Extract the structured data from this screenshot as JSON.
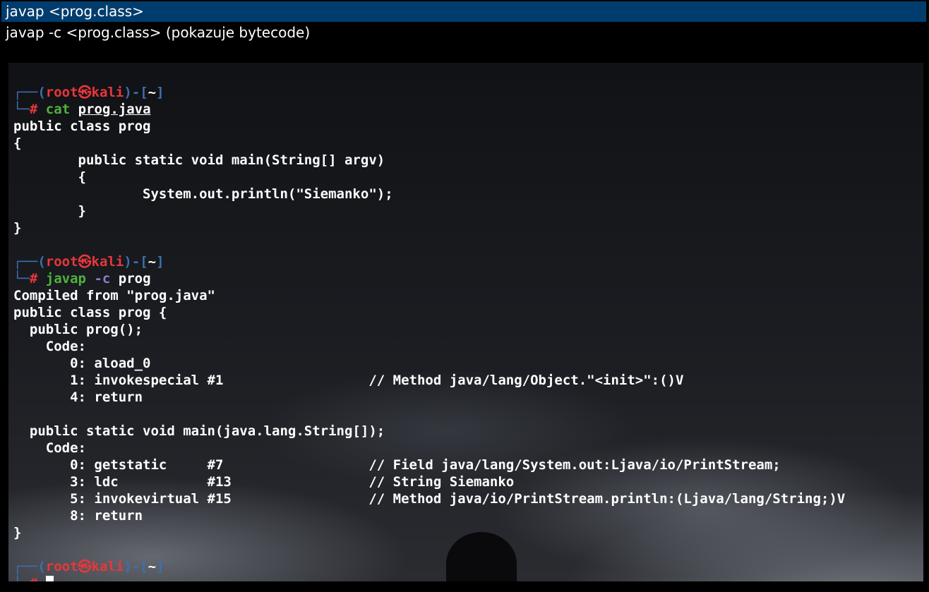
{
  "window": {
    "title": "javap <prog.class>",
    "subtitle": "javap -c <prog.class> (pokazuje bytecode)"
  },
  "prompt": {
    "open": "┌──(",
    "user": "root",
    "at": "㉿",
    "host": "kali",
    "close": ")-[",
    "dir": "~",
    "end": "]",
    "hash_prefix": "└─",
    "hash": "#"
  },
  "session": {
    "cmd1": {
      "name": "cat",
      "arg": "prog.java"
    },
    "java_source": [
      "public class prog",
      "{",
      "        public static void main(String[] argv)",
      "        {",
      "                System.out.println(\"Siemanko\");",
      "        }",
      "}"
    ],
    "cmd2": {
      "name": "javap",
      "flag": "-c",
      "arg": "prog"
    },
    "bytecode_output": [
      "Compiled from \"prog.java\"",
      "public class prog {",
      "  public prog();",
      "    Code:",
      "       0: aload_0",
      "       1: invokespecial #1                  // Method java/lang/Object.\"<init>\":()V",
      "       4: return",
      "",
      "  public static void main(java.lang.String[]);",
      "    Code:",
      "       0: getstatic     #7                  // Field java/lang/System.out:Ljava/io/PrintStream;",
      "       3: ldc           #13                 // String Siemanko",
      "       5: invokevirtual #15                 // Method java/io/PrintStream.println:(Ljava/lang/String;)V",
      "       8: return",
      "}"
    ]
  }
}
